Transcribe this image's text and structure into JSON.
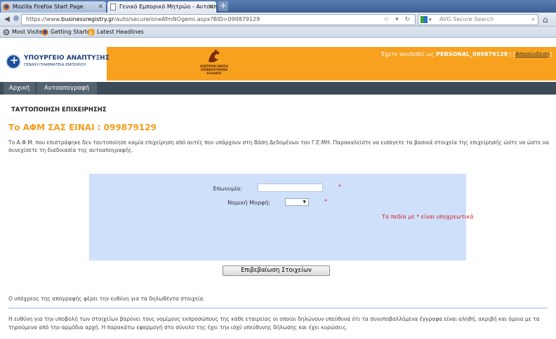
{
  "browser": {
    "tabs": [
      {
        "label": "Mozilla Firefox Start Page",
        "active": false
      },
      {
        "label": "Γενικό Εμπορικό Μητρώο - Αυτοαπ...",
        "active": true
      }
    ],
    "new_tab_label": "+",
    "url_prefix": "https://www.",
    "url_domain": "businessregistry.gr",
    "url_rest": "/auto/secure/oneAfmNOgemi.aspx?BID=099879129",
    "search_placeholder": "AVG Secure Search",
    "bookmarks": [
      {
        "label": "Most Visited",
        "icon": "gear-icon"
      },
      {
        "label": "Getting Started",
        "icon": "firefox-icon"
      },
      {
        "label": "Latest Headlines",
        "icon": "rss-feed-icon"
      }
    ]
  },
  "header": {
    "ministry_line1": "ΥΠΟΥΡΓΕΙΟ ΑΝΑΠΤΥΞΗΣ",
    "ministry_line2": "ΓΕΝΙΚΗ ΓΡΑΜΜΑΤΕΙΑ ΕΜΠΟΡΙΟΥ",
    "logo_line1": "ΚΕΝΤΡΙΚΗ ΕΝΩΣΗ",
    "logo_line2": "ΕΠΙΜΕΛΗΤΗΡΙΩΝ",
    "logo_line3": "ΕΛΛΑΔΟΣ",
    "login_prefix": "Έχετε συνδεθεί ως",
    "login_user": "PERSONAL_099879129",
    "logout_label": "Αποσύνδεση",
    "accent_color": "#f7a11f"
  },
  "menu": {
    "home": "Αρχική",
    "self_registration": "Αυτοαπογραφή"
  },
  "main": {
    "title": "ΤΑΥΤΟΠΟΙΗΣΗ ΕΠΙΧΕΙΡΗΣΗΣ",
    "afm_heading": "Το ΑΦΜ ΣΑΣ ΕΙΝΑΙ : 099879129",
    "intro": "Το Α.Φ.Μ. που επιστράφηκε δεν ταυτοποίησε καμία επιχείρηση από αυτές που υπάρχουν στη Βάση Δεδομένων του Γ.Ε.ΜΗ. Παρακαλείστε να εισάγετε τα βασικά στοιχεία της επιχείρησής ώστε να ώστε να συνεχίσετε τη διαδικασία της αυτοαπογραφής.",
    "form": {
      "name_label": "Επωνυμία:",
      "name_value": "",
      "legal_form_label": "Νομική Μορφή:",
      "legal_form_value": "",
      "required_mark": "*",
      "required_note": "Τα πεδία με * είναι υποχρεωτικά"
    },
    "submit_label": "Επιβεβαίωση Στοιχείων",
    "responsibility": "Ο υπόχρεος της απογραφής φέρει την ευθύνη για τα δηλωθέντα στοιχεία.",
    "footnote": "Η ευθύνη για την υποβολή των στοιχείων βαρύνει τους νομίμους εκπροσώπους της κάθε εταιρείας οι οποίοι δηλώνουν υπεύθυνα ότι τα συνυποβαλλόμενα έγγραφα είναι αληθή, ακριβή και όμοια με τα τηρούμενα από την αρμόδια αρχή. Η παρακάτω εφαρμογή στο σύνολο της έχει την ισχύ υπεύθυνης δήλωσης και έχει κυρώσεις."
  }
}
